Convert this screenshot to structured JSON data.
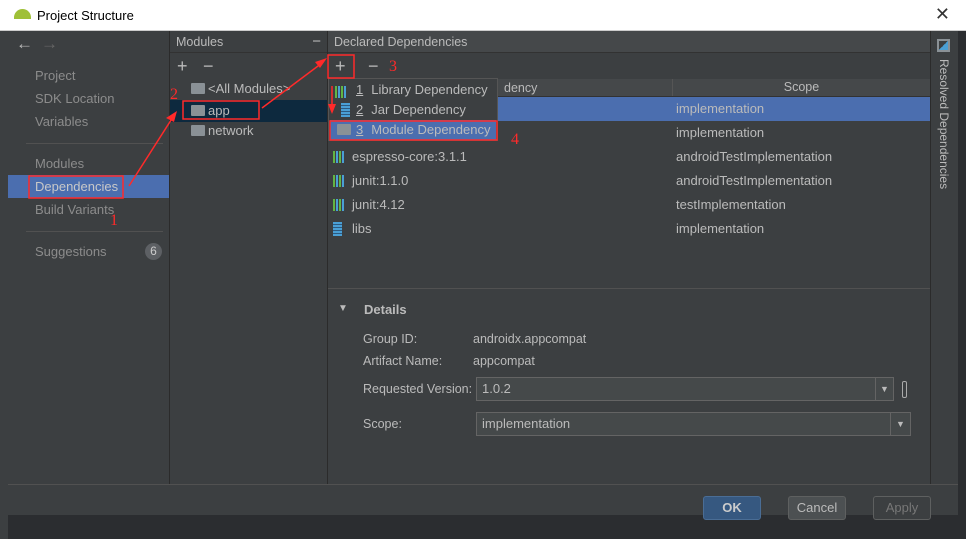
{
  "window": {
    "title": "Project Structure",
    "close": "✕"
  },
  "nav": {
    "back": "←",
    "forward": "→",
    "items": [
      {
        "label": "Project"
      },
      {
        "label": "SDK Location"
      },
      {
        "label": "Variables"
      },
      {
        "label": "Modules"
      },
      {
        "label": "Dependencies",
        "selected": true
      },
      {
        "label": "Build Variants"
      },
      {
        "label": "Suggestions",
        "badge": "6"
      }
    ]
  },
  "modules": {
    "title": "Modules",
    "collapse": "−",
    "add": "+",
    "remove": "−",
    "items": [
      {
        "label": "<All Modules>"
      },
      {
        "label": "app",
        "selected": true
      },
      {
        "label": "network"
      }
    ]
  },
  "deps": {
    "title": "Declared Dependencies",
    "add": "+",
    "remove": "−",
    "columns": [
      "Dependency",
      "Scope"
    ],
    "column_visible": "dency",
    "rows": [
      {
        "name": "",
        "scope": "implementation",
        "selected": true,
        "icon": "library"
      },
      {
        "name": "",
        "scope": "implementation",
        "icon": "library"
      },
      {
        "name": "espresso-core:3.1.1",
        "scope": "androidTestImplementation",
        "icon": "library"
      },
      {
        "name": "junit:1.1.0",
        "scope": "androidTestImplementation",
        "icon": "library"
      },
      {
        "name": "junit:4.12",
        "scope": "testImplementation",
        "icon": "library"
      },
      {
        "name": "libs",
        "scope": "implementation",
        "icon": "jar"
      }
    ]
  },
  "popup": {
    "items": [
      {
        "num": "1",
        "label": "Library Dependency"
      },
      {
        "num": "2",
        "label": "Jar Dependency"
      },
      {
        "num": "3",
        "label": "Module Dependency",
        "selected": true
      }
    ]
  },
  "details": {
    "title": "Details",
    "group_label": "Group ID:",
    "group": "androidx.appcompat",
    "artifact_label": "Artifact Name:",
    "artifact": "appcompat",
    "version_label": "Requested Version:",
    "version": "1.0.2",
    "scope_label": "Scope:",
    "scope": "implementation"
  },
  "side": {
    "resolved": "Resolved Dependencies"
  },
  "buttons": {
    "ok": "OK",
    "cancel": "Cancel",
    "apply": "Apply"
  },
  "annotations": {
    "n1": "1",
    "n2": "2",
    "n3": "3",
    "n4": "4",
    "color": "#ff2a2a"
  },
  "colors": {
    "selection": "#4b6eaf",
    "panel": "#3c3f41",
    "ok": "#365880"
  }
}
